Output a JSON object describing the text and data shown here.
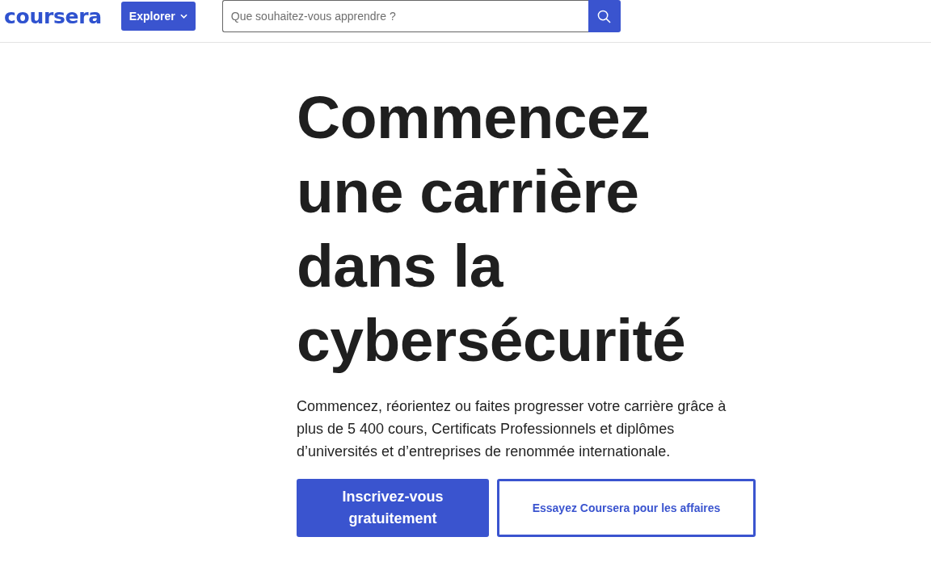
{
  "header": {
    "logo": "coursera",
    "explore_button": {
      "label": "Explorer"
    },
    "search": {
      "placeholder": "Que souhaitez-vous apprendre ?"
    }
  },
  "hero": {
    "title": "Commencez une carrière dans la cybersécurité",
    "description": "Commencez, réorientez ou faites progresser votre carrière grâce à plus de 5 400 cours, Certificats Professionnels et diplômes d’universités et d’entreprises de renommée internationale.",
    "buttons": [
      {
        "label": "Inscrivez-vous gratuitement",
        "kind": "primary"
      },
      {
        "label": "Essayez Coursera pour les affaires",
        "kind": "secondary"
      }
    ]
  }
}
